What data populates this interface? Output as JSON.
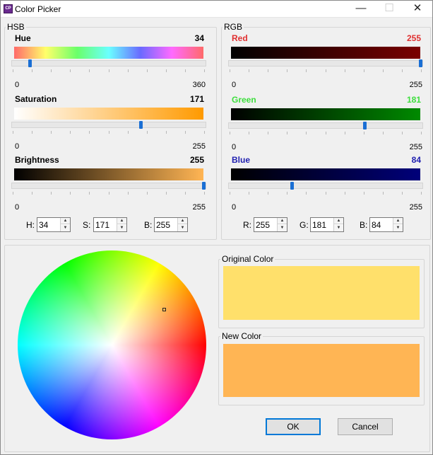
{
  "window": {
    "title": "Color Picker",
    "icon": "app-icon",
    "minimize": "—",
    "maximize": "☐",
    "close": "✕"
  },
  "hsb": {
    "title": "HSB",
    "hue": {
      "label": "Hue",
      "value": "34",
      "min": "0",
      "max": "360",
      "fraction": 0.094
    },
    "saturation": {
      "label": "Saturation",
      "value": "171",
      "min": "0",
      "max": "255",
      "fraction": 0.671
    },
    "brightness": {
      "label": "Brightness",
      "value": "255",
      "min": "0",
      "max": "255",
      "fraction": 1.0
    },
    "spinners": {
      "h_label": "H:",
      "h_value": "34",
      "s_label": "S:",
      "s_value": "171",
      "b_label": "B:",
      "b_value": "255"
    }
  },
  "rgb": {
    "title": "RGB",
    "red": {
      "label": "Red",
      "value": "255",
      "min": "0",
      "max": "255",
      "fraction": 1.0,
      "color": "#e03030"
    },
    "green": {
      "label": "Green",
      "value": "181",
      "min": "0",
      "max": "255",
      "fraction": 0.71,
      "color": "#3dde3d"
    },
    "blue": {
      "label": "Blue",
      "value": "84",
      "min": "0",
      "max": "255",
      "fraction": 0.33,
      "color": "#2020b0"
    },
    "spinners": {
      "r_label": "R:",
      "r_value": "255",
      "g_label": "G:",
      "g_value": "181",
      "b_label": "B:",
      "b_value": "84"
    }
  },
  "original": {
    "label": "Original Color",
    "color": "#ffe06b"
  },
  "new": {
    "label": "New Color",
    "color": "#ffb554"
  },
  "buttons": {
    "ok": "OK",
    "cancel": "Cancel"
  },
  "colors": {
    "accent": "#1a6fd4",
    "hue_color": "#ff9a00"
  }
}
